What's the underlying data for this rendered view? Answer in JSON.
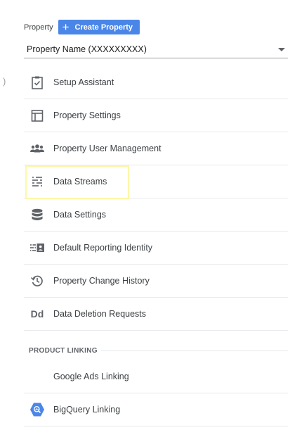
{
  "edge_mark": ")",
  "property": {
    "label": "Property",
    "create_button_label": "Create Property",
    "selected_property": "Property Name (XXXXXXXXX)"
  },
  "menu": {
    "items": [
      {
        "label": "Setup Assistant",
        "icon": "clipboard-check-icon"
      },
      {
        "label": "Property Settings",
        "icon": "window-layout-icon"
      },
      {
        "label": "Property User Management",
        "icon": "people-icon"
      },
      {
        "label": "Data Streams",
        "icon": "data-streams-icon"
      },
      {
        "label": "Data Settings",
        "icon": "database-icon"
      },
      {
        "label": "Default Reporting Identity",
        "icon": "reporting-identity-icon"
      },
      {
        "label": "Property Change History",
        "icon": "history-icon"
      },
      {
        "label": "Data Deletion Requests",
        "icon": "dd-icon",
        "icon_text": "Dd"
      }
    ]
  },
  "product_linking": {
    "heading": "PRODUCT LINKING",
    "items": [
      {
        "label": "Google Ads Linking",
        "icon": "google-ads-icon"
      },
      {
        "label": "BigQuery Linking",
        "icon": "bigquery-icon"
      }
    ]
  },
  "colors": {
    "accent_blue": "#4a86e8",
    "highlight_yellow": "#fdf7a8",
    "icon_gray": "#5f6368"
  }
}
